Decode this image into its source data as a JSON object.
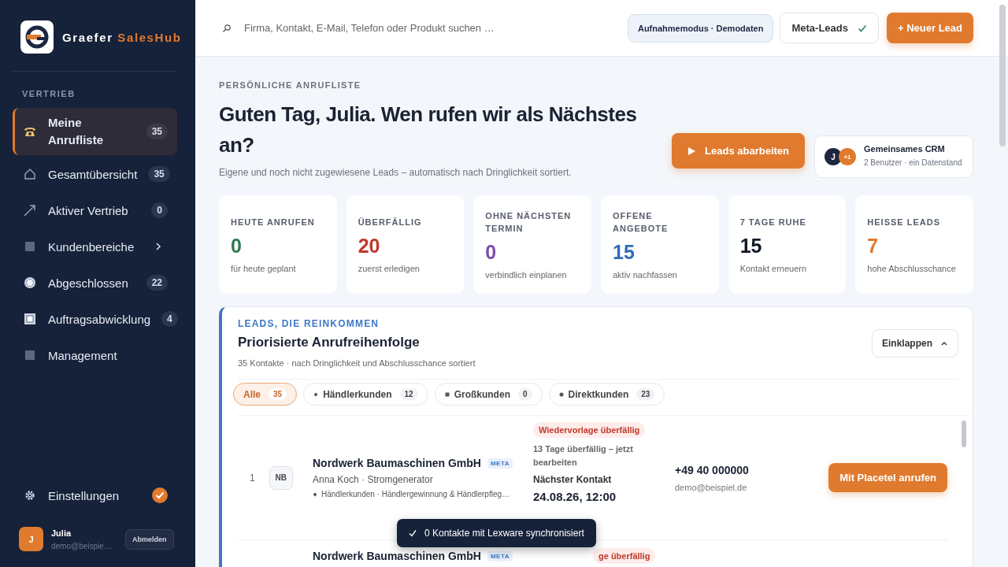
{
  "brand": {
    "name": "Graefer",
    "accent": "SalesHub"
  },
  "sidebar": {
    "section": "VERTRIEB",
    "items": [
      {
        "label": "Meine Anrufliste",
        "count": "35",
        "selected": true
      },
      {
        "label": "Gesamtübersicht",
        "count": "35",
        "selected": false
      },
      {
        "label": "Aktiver Vertrieb",
        "count": "0",
        "selected": false
      },
      {
        "label": "Kundenbereiche",
        "expandable": true,
        "selected": false
      },
      {
        "label": "Abgeschlossen",
        "count": "22",
        "selected": false
      },
      {
        "label": "Auftragsabwicklung",
        "count": "4",
        "selected": false
      },
      {
        "label": "Management",
        "selected": false
      }
    ],
    "settings": {
      "label": "Einstellungen",
      "checked": true
    },
    "user": {
      "initial": "J",
      "name": "Julia",
      "email": "demo@beispie…",
      "logout": "Abmelden"
    }
  },
  "topbar": {
    "search_placeholder": "Firma, Kontakt, E-Mail, Telefon oder Produkt suchen …",
    "mode": "Aufnahmemodus · Demodaten",
    "meta": {
      "label": "Meta-Leads",
      "checked": true
    },
    "new_lead": "+ Neuer Lead"
  },
  "hero": {
    "eyebrow": "PERSÖNLICHE ANRUFLISTE",
    "title": "Guten Tag, Julia. Wen rufen wir als Nächstes an?",
    "subtitle": "Eigene und noch nicht zugewiesene Leads – automatisch nach Dringlichkeit sortiert.",
    "action": "Leads abarbeiten",
    "crm": {
      "avatar": "J",
      "extra": "+1",
      "title": "Gemeinsames CRM",
      "text": "2 Benutzer · ein Datenstand"
    }
  },
  "stats": [
    {
      "label": "HEUTE ANRUFEN",
      "value": "0",
      "note": "für heute geplant",
      "color": "#2f7a4f"
    },
    {
      "label": "ÜBERFÄLLIG",
      "value": "20",
      "note": "zuerst erledigen",
      "color": "#c0392b"
    },
    {
      "label": "OHNE NÄCHSTEN TERMIN",
      "value": "0",
      "note": "verbindlich einplanen",
      "color": "#7b4fa8"
    },
    {
      "label": "OFFENE ANGEBOTE",
      "value": "15",
      "note": "aktiv nachfassen",
      "color": "#2f6db5"
    },
    {
      "label": "7 TAGE RUHE",
      "value": "15",
      "note": "Kontakt erneuern",
      "color": "#111827"
    },
    {
      "label": "HEISSE LEADS",
      "value": "7",
      "note": "hohe Abschlusschance",
      "color": "#e07a2e"
    }
  ],
  "queue": {
    "eyebrow": "LEADS, DIE REINKOMMEN",
    "title": "Priorisierte Anrufreihenfolge",
    "subtitle": "35 Kontakte · nach Dringlichkeit und Abschlusschance sortiert",
    "collapse": "Einklappen",
    "filters": [
      {
        "label": "Alle",
        "count": "35",
        "selected": true,
        "kind": "none"
      },
      {
        "label": "Händlerkunden",
        "count": "12",
        "selected": false,
        "kind": "diamond"
      },
      {
        "label": "Großkunden",
        "count": "0",
        "selected": false,
        "kind": "square"
      },
      {
        "label": "Direktkunden",
        "count": "23",
        "selected": false,
        "kind": "dot"
      }
    ],
    "rows": [
      {
        "kind": "full",
        "rank": "1",
        "initials": "NB",
        "company": "Nordwerk Baumaschinen GmbH",
        "tag": "META",
        "contact": "Anna Koch · Stromgenerator",
        "segment": "Händlerkunden · Händlergewinnung & Händlerpfleg…",
        "badge": "Wiedervorlage überfällig",
        "overdue": "13 Tage überfällig – jetzt bearbeiten",
        "next_label": "Nächster Kontakt",
        "next_value": "24.08.26, 12:00",
        "phone": "+49 40 000000",
        "email": "demo@beispiel.de",
        "call": "Mit Placetel anrufen"
      },
      {
        "kind": "partial",
        "company": "Nordwerk Baumaschinen GmbH",
        "tag": "META",
        "badge": "ge überfällig"
      }
    ]
  },
  "toast": {
    "text": "0 Kontakte mit Lexware synchronisiert"
  }
}
